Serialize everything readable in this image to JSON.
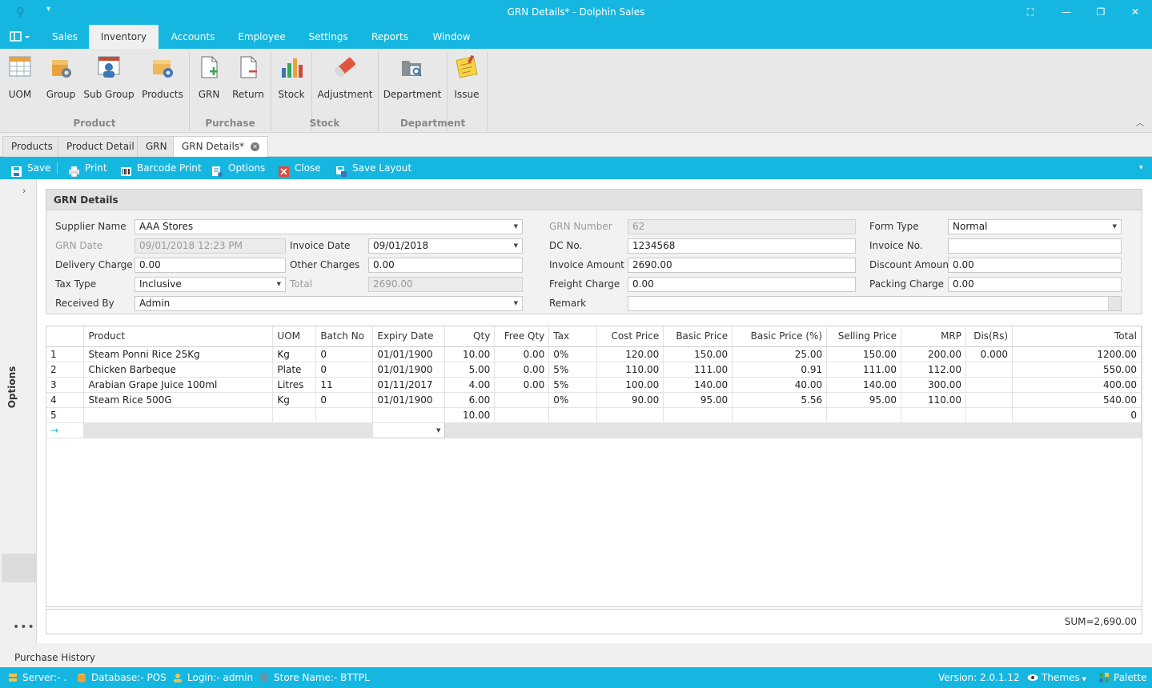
{
  "window": {
    "title": "GRN Details* - Dolphin Sales"
  },
  "menu": {
    "tabs": [
      "Sales",
      "Inventory",
      "Accounts",
      "Employee",
      "Settings",
      "Reports",
      "Window"
    ]
  },
  "ribbon": {
    "buttons": [
      "UOM",
      "Group",
      "Sub Group",
      "Products",
      "GRN",
      "Return",
      "Stock",
      "Adjustment",
      "Department",
      "Issue"
    ],
    "groups": [
      "Product",
      "Purchase",
      "Stock",
      "Department"
    ]
  },
  "doctabs": [
    "Products",
    "Product Detail",
    "GRN",
    "GRN Details*"
  ],
  "toolbar": {
    "save": "Save",
    "print": "Print",
    "barcode": "Barcode Print",
    "options": "Options",
    "close": "Close",
    "save_layout": "Save Layout"
  },
  "side": {
    "options": "Options",
    "more": "•••"
  },
  "form": {
    "heading": "GRN Details",
    "supplier_label": "Supplier Name",
    "supplier": "AAA Stores",
    "grn_date_label": "GRN Date",
    "grn_date": "09/01/2018 12:23 PM",
    "invoice_date_label": "Invoice Date",
    "invoice_date": "09/01/2018",
    "delivery_label": "Delivery Charge",
    "delivery": "0.00",
    "other_label": "Other Charges",
    "other": "0.00",
    "tax_type_label": "Tax Type",
    "tax_type": "Inclusive",
    "total_label": "Total",
    "total": "2690.00",
    "received_label": "Received By",
    "received": "Admin",
    "grn_number_label": "GRN Number",
    "grn_number": "62",
    "dc_label": "DC No.",
    "dc": "1234568",
    "invoice_amount_label": "Invoice Amount",
    "invoice_amount": "2690.00",
    "freight_label": "Freight Charge",
    "freight": "0.00",
    "remark_label": "Remark",
    "remark": "",
    "form_type_label": "Form Type",
    "form_type": "Normal",
    "invoice_no_label": "Invoice No.",
    "invoice_no": "",
    "discount_label": "Discount Amount",
    "discount": "0.00",
    "packing_label": "Packing Charge",
    "packing": "0.00"
  },
  "grid": {
    "columns": [
      "",
      "Product",
      "UOM",
      "Batch No",
      "Expiry Date",
      "Qty",
      "Free Qty",
      "Tax",
      "Cost Price",
      "Basic Price",
      "Basic Price (%)",
      "Selling Price",
      "MRP",
      "Dis(Rs)",
      "Total"
    ],
    "rows": [
      [
        "1",
        "Steam Ponni Rice 25Kg",
        "Kg",
        "0",
        "01/01/1900",
        "10.00",
        "0.00",
        "0%",
        "120.00",
        "150.00",
        "25.00",
        "150.00",
        "200.00",
        "0.000",
        "1200.00"
      ],
      [
        "2",
        "Chicken Barbeque",
        "Plate",
        "0",
        "01/01/1900",
        "5.00",
        "0.00",
        "5%",
        "110.00",
        "111.00",
        "0.91",
        "111.00",
        "112.00",
        "",
        "550.00"
      ],
      [
        "3",
        "Arabian Grape Juice 100ml",
        "Litres",
        "11",
        "01/11/2017",
        "4.00",
        "0.00",
        "5%",
        "100.00",
        "140.00",
        "40.00",
        "140.00",
        "300.00",
        "",
        "400.00"
      ],
      [
        "4",
        "Steam Rice 500G",
        "Kg",
        "0",
        "01/01/1900",
        "6.00",
        "",
        "0%",
        "90.00",
        "95.00",
        "5.56",
        "95.00",
        "110.00",
        "",
        "540.00"
      ],
      [
        "5",
        "",
        "",
        "",
        "",
        "10.00",
        "",
        "",
        "",
        "",
        "",
        "",
        "",
        "",
        "0"
      ]
    ],
    "new_row_indicator": "→",
    "sum": "SUM=2,690.00"
  },
  "purchase_history": "Purchase History",
  "status": {
    "server": "Server:- .",
    "database": "Database:- POS",
    "login": "Login:- admin",
    "store": "Store Name:- BTTPL",
    "version": "Version: 2.0.1.12",
    "themes": "Themes",
    "palette": "Palette"
  }
}
